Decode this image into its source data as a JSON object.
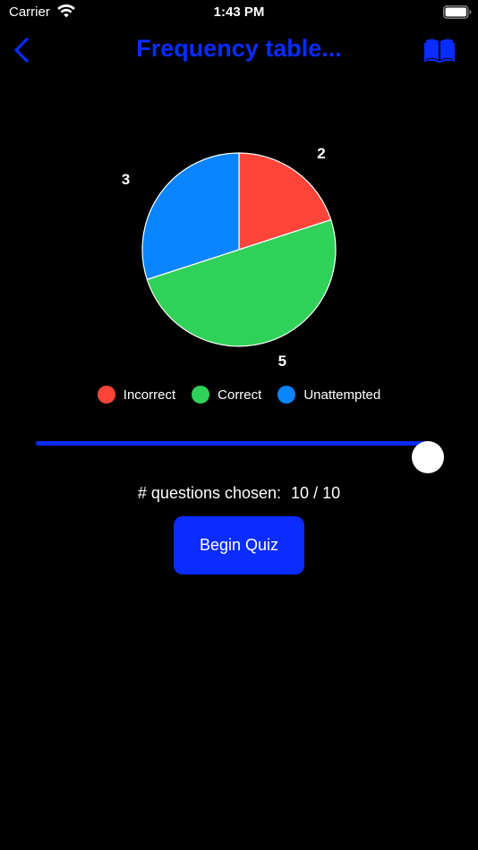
{
  "status_bar": {
    "carrier": "Carrier",
    "time": "1:43 PM",
    "wifi_icon": "wifi-icon",
    "battery_icon": "battery-full-icon"
  },
  "nav": {
    "back_icon": "chevron-left-icon",
    "title": "Frequency table...",
    "book_icon": "book-open-icon",
    "accent_color": "#0a2cff"
  },
  "chart_data": {
    "type": "pie",
    "slices": [
      {
        "label": "Incorrect",
        "value": 2,
        "color": "#ff453a"
      },
      {
        "label": "Correct",
        "value": 5,
        "color": "#30d158"
      },
      {
        "label": "Unattempted",
        "value": 3,
        "color": "#0a84ff"
      }
    ],
    "legend": [
      "Incorrect",
      "Correct",
      "Unattempted"
    ],
    "legend_position": "bottom"
  },
  "slider": {
    "value": 10,
    "min": 0,
    "max": 10,
    "fill_color": "#0a2cff"
  },
  "question_count": {
    "label": "# questions chosen:",
    "value": "10 / 10"
  },
  "begin_button": {
    "label": "Begin Quiz",
    "color": "#0a2cff"
  }
}
